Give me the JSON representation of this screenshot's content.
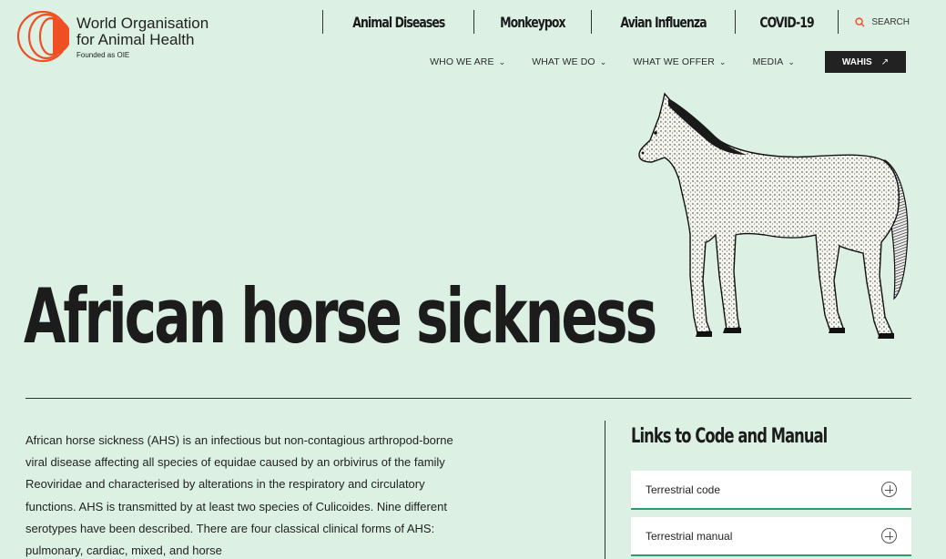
{
  "logo": {
    "line1": "World Organisation",
    "line2": "for Animal Health",
    "subtitle": "Founded as OIE",
    "brand_color": "#f04e23"
  },
  "top_nav": {
    "links": [
      "Animal Diseases",
      "Monkeypox",
      "Avian Influenza",
      "COVID-19"
    ],
    "search_label": "SEARCH",
    "search_icon_color": "#f04e23"
  },
  "main_nav": {
    "items": [
      "WHO WE ARE",
      "WHAT WE DO",
      "WHAT WE OFFER",
      "MEDIA"
    ],
    "cta_label": "WAHIS",
    "cta_arrow": "↗"
  },
  "hero": {
    "title": "African horse sickness",
    "image": "horse-illustration"
  },
  "intro": {
    "text": "African horse sickness (AHS) is an infectious but non-contagious arthropod-borne viral disease affecting all species of equidae caused by an orbivirus of the family Reoviridae and characterised by alterations in the respiratory and circulatory functions. AHS is transmitted by at least two species of Culicoides. Nine different serotypes have been described. There are four classical clinical forms of AHS: pulmonary, cardiac, mixed, and horse"
  },
  "links_panel": {
    "title": "Links to Code and Manual",
    "items": [
      "Terrestrial code",
      "Terrestrial manual"
    ],
    "accent": "#2b9b71"
  },
  "colors": {
    "background": "#dcf1e4",
    "text": "#1d1d1d"
  }
}
